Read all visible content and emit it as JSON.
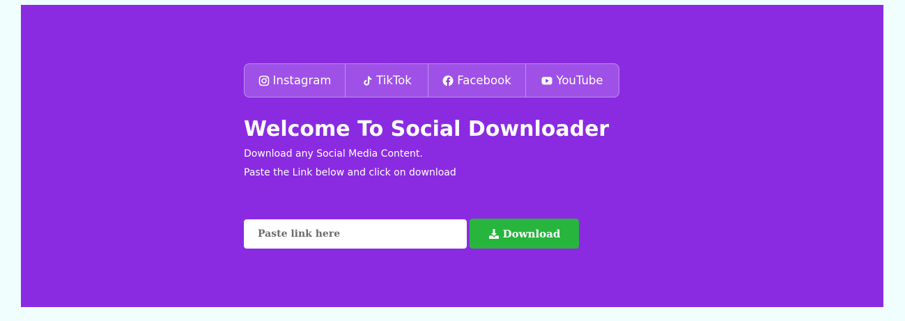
{
  "tabs": [
    {
      "label": "Instagram",
      "icon": "instagram-icon"
    },
    {
      "label": "TikTok",
      "icon": "tiktok-icon"
    },
    {
      "label": "Facebook",
      "icon": "facebook-icon"
    },
    {
      "label": "YouTube",
      "icon": "youtube-icon"
    }
  ],
  "hero": {
    "title": "Welcome To Social Downloader",
    "subtitle_line1": "Download any Social Media Content.",
    "subtitle_line2": "Paste the Link below and click on download"
  },
  "form": {
    "input_placeholder": "Paste link here",
    "input_value": "",
    "download_label": "Download",
    "download_icon": "download-icon"
  },
  "colors": {
    "page_background": "#f0fffe",
    "hero_background": "#8a2be2",
    "button_background": "#28b53e"
  }
}
